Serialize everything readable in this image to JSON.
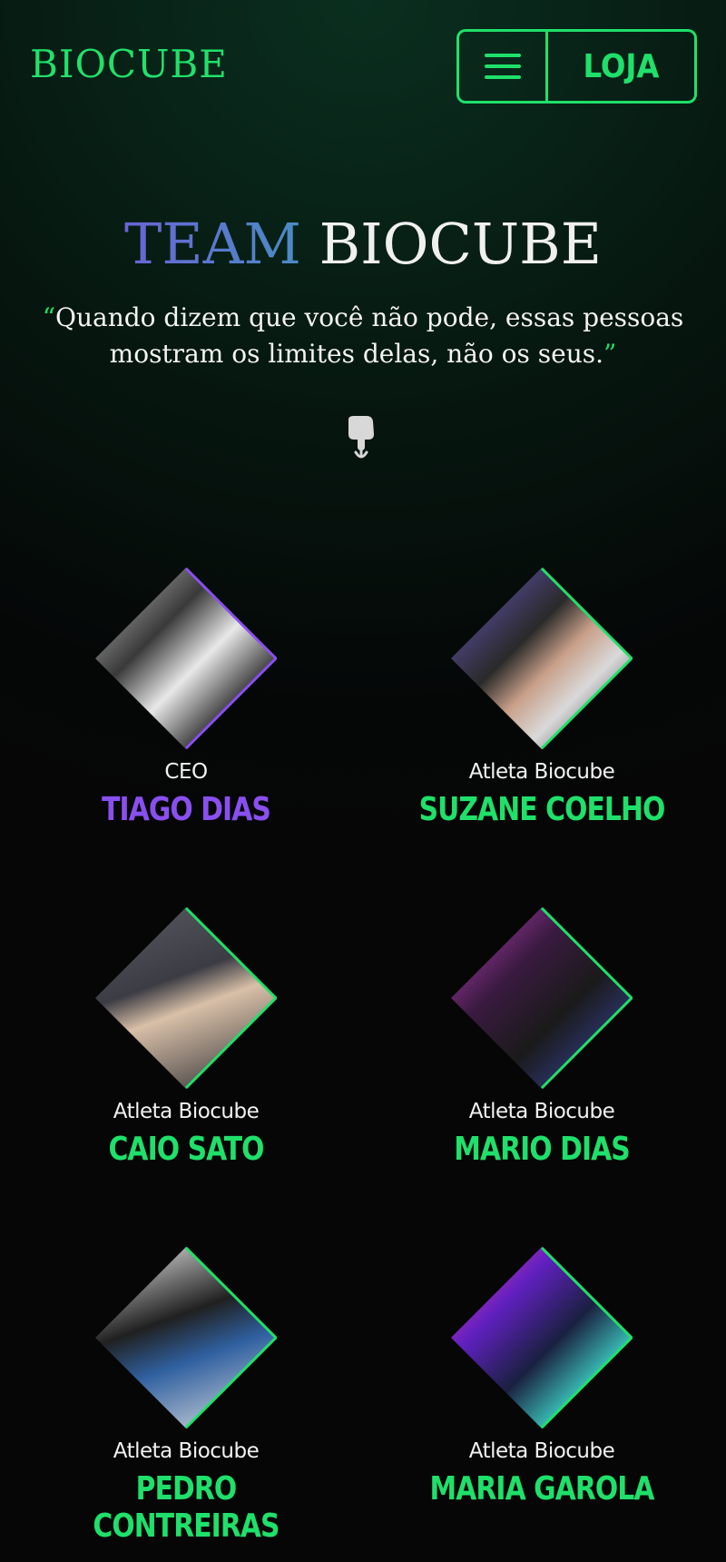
{
  "header": {
    "brand": "BIOCUBE",
    "menu_icon": "hamburger-menu-icon",
    "shop_label": "LOJA"
  },
  "hero": {
    "title_accent": "TEAM",
    "title_main": "BIOCUBE",
    "quote_open": "“",
    "quote_text": "Quando dizem que você não pode, essas pessoas mostram os limites delas, não os seus.",
    "quote_close": "”",
    "scroll_icon": "hand-pointing-down-icon"
  },
  "colors": {
    "accent_green": "#1fe06a",
    "accent_purple": "#8a4ff0",
    "title_gradient_start": "#6a64d6",
    "title_gradient_end": "#4a8cc4"
  },
  "team": [
    {
      "role": "CEO",
      "name": "TIAGO DIAS",
      "accent": "#8a4ff0"
    },
    {
      "role": "Atleta Biocube",
      "name": "SUZANE COELHO",
      "accent": "#1fe06a"
    },
    {
      "role": "Atleta Biocube",
      "name": "CAIO SATO",
      "accent": "#1fe06a"
    },
    {
      "role": "Atleta Biocube",
      "name": "MARIO DIAS",
      "accent": "#1fe06a"
    },
    {
      "role": "Atleta Biocube",
      "name": "PEDRO CONTREIRAS",
      "accent": "#1fe06a"
    },
    {
      "role": "Atleta Biocube",
      "name": "MARIA GAROLA",
      "accent": "#1fe06a"
    }
  ]
}
